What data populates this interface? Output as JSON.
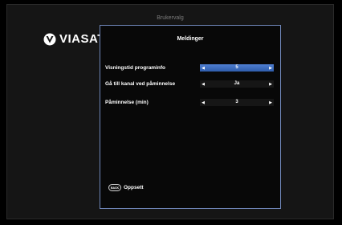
{
  "window": {
    "title": "Brukervalg"
  },
  "brand": {
    "name": "VIASAT",
    "icon": "viasat-logo-icon"
  },
  "panel": {
    "title": "Meldinger",
    "rows": [
      {
        "label": "Visningstid programinfo",
        "value": "5",
        "active": true
      },
      {
        "label": "Gå till kanal ved påminnelse",
        "value": "Ja",
        "active": false
      },
      {
        "label": "Påminnelse (min)",
        "value": "3",
        "active": false
      }
    ],
    "back": {
      "button_label": "BACK",
      "label": "Oppsett"
    }
  },
  "colors": {
    "accent": "#4f7fd2",
    "panel_border": "#6f86b9",
    "background": "#000000"
  }
}
